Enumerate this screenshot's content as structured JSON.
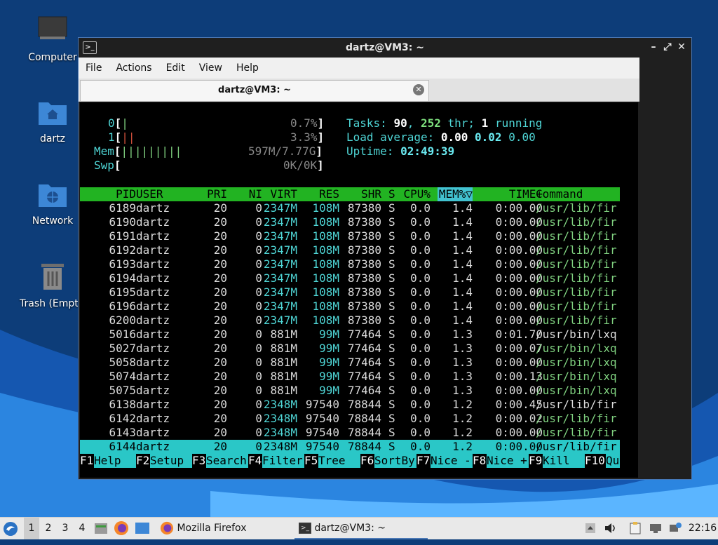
{
  "desktop": {
    "icons": [
      {
        "label": "Computer",
        "icon": "computer-icon"
      },
      {
        "label": "dartz",
        "icon": "home-folder-icon"
      },
      {
        "label": "Network",
        "icon": "network-folder-icon"
      },
      {
        "label": "Trash (Empt",
        "icon": "trash-icon"
      }
    ]
  },
  "window": {
    "title": "dartz@VM3: ~",
    "controls": {
      "minimize": "–",
      "maximize": "⤢",
      "close": "✕"
    },
    "menu": [
      "File",
      "Actions",
      "Edit",
      "View",
      "Help"
    ],
    "tab": {
      "label": "dartz@VM3: ~",
      "close": "✕"
    }
  },
  "htop": {
    "meters": {
      "cpu0": {
        "label": "0",
        "bars": "|",
        "value": "0.7%"
      },
      "cpu1": {
        "label": "1",
        "bars": "||",
        "value": "3.3%"
      },
      "mem": {
        "label": "Mem",
        "bars": "|||||||||",
        "value": "597M/7.77G"
      },
      "swp": {
        "label": "Swp",
        "bars": "",
        "value": "0K/0K"
      }
    },
    "tasks": {
      "prefix": "Tasks: ",
      "count": "90",
      "sep": ", ",
      "threads": "252",
      "thr_label": " thr; ",
      "running": "1",
      "running_label": " running"
    },
    "load": {
      "label": "Load average: ",
      "v1": "0.00",
      "v5": "0.02",
      "v15": "0.00"
    },
    "uptime": {
      "label": "Uptime: ",
      "value": "02:49:39"
    },
    "columns": [
      "PID",
      "USER",
      "PRI",
      "NI",
      "VIRT",
      "RES",
      "SHR",
      "S",
      "CPU%",
      "MEM%▽",
      "TIME+",
      "Command"
    ],
    "processes": [
      {
        "pid": "6189",
        "user": "dartz",
        "pri": "20",
        "ni": "0",
        "virt": "2347M",
        "res": "108M",
        "shr": "87380",
        "s": "S",
        "cpu": "0.0",
        "mem": "1.4",
        "time": "0:00.00",
        "cmd": "/usr/lib/fir",
        "thread": true
      },
      {
        "pid": "6190",
        "user": "dartz",
        "pri": "20",
        "ni": "0",
        "virt": "2347M",
        "res": "108M",
        "shr": "87380",
        "s": "S",
        "cpu": "0.0",
        "mem": "1.4",
        "time": "0:00.00",
        "cmd": "/usr/lib/fir",
        "thread": true
      },
      {
        "pid": "6191",
        "user": "dartz",
        "pri": "20",
        "ni": "0",
        "virt": "2347M",
        "res": "108M",
        "shr": "87380",
        "s": "S",
        "cpu": "0.0",
        "mem": "1.4",
        "time": "0:00.00",
        "cmd": "/usr/lib/fir",
        "thread": true
      },
      {
        "pid": "6192",
        "user": "dartz",
        "pri": "20",
        "ni": "0",
        "virt": "2347M",
        "res": "108M",
        "shr": "87380",
        "s": "S",
        "cpu": "0.0",
        "mem": "1.4",
        "time": "0:00.00",
        "cmd": "/usr/lib/fir",
        "thread": true
      },
      {
        "pid": "6193",
        "user": "dartz",
        "pri": "20",
        "ni": "0",
        "virt": "2347M",
        "res": "108M",
        "shr": "87380",
        "s": "S",
        "cpu": "0.0",
        "mem": "1.4",
        "time": "0:00.00",
        "cmd": "/usr/lib/fir",
        "thread": true
      },
      {
        "pid": "6194",
        "user": "dartz",
        "pri": "20",
        "ni": "0",
        "virt": "2347M",
        "res": "108M",
        "shr": "87380",
        "s": "S",
        "cpu": "0.0",
        "mem": "1.4",
        "time": "0:00.00",
        "cmd": "/usr/lib/fir",
        "thread": true
      },
      {
        "pid": "6195",
        "user": "dartz",
        "pri": "20",
        "ni": "0",
        "virt": "2347M",
        "res": "108M",
        "shr": "87380",
        "s": "S",
        "cpu": "0.0",
        "mem": "1.4",
        "time": "0:00.00",
        "cmd": "/usr/lib/fir",
        "thread": true
      },
      {
        "pid": "6196",
        "user": "dartz",
        "pri": "20",
        "ni": "0",
        "virt": "2347M",
        "res": "108M",
        "shr": "87380",
        "s": "S",
        "cpu": "0.0",
        "mem": "1.4",
        "time": "0:00.00",
        "cmd": "/usr/lib/fir",
        "thread": true
      },
      {
        "pid": "6200",
        "user": "dartz",
        "pri": "20",
        "ni": "0",
        "virt": "2347M",
        "res": "108M",
        "shr": "87380",
        "s": "S",
        "cpu": "0.0",
        "mem": "1.4",
        "time": "0:00.00",
        "cmd": "/usr/lib/fir",
        "thread": true
      },
      {
        "pid": "5016",
        "user": "dartz",
        "pri": "20",
        "ni": "0",
        "virt": "881M",
        "res": "99M",
        "shr": "77464",
        "s": "S",
        "cpu": "0.0",
        "mem": "1.3",
        "time": "0:01.70",
        "cmd": "/usr/bin/lxq",
        "thread": false
      },
      {
        "pid": "5027",
        "user": "dartz",
        "pri": "20",
        "ni": "0",
        "virt": "881M",
        "res": "99M",
        "shr": "77464",
        "s": "S",
        "cpu": "0.0",
        "mem": "1.3",
        "time": "0:00.07",
        "cmd": "/usr/bin/lxq",
        "thread": true
      },
      {
        "pid": "5058",
        "user": "dartz",
        "pri": "20",
        "ni": "0",
        "virt": "881M",
        "res": "99M",
        "shr": "77464",
        "s": "S",
        "cpu": "0.0",
        "mem": "1.3",
        "time": "0:00.00",
        "cmd": "/usr/bin/lxq",
        "thread": true
      },
      {
        "pid": "5074",
        "user": "dartz",
        "pri": "20",
        "ni": "0",
        "virt": "881M",
        "res": "99M",
        "shr": "77464",
        "s": "S",
        "cpu": "0.0",
        "mem": "1.3",
        "time": "0:00.13",
        "cmd": "/usr/bin/lxq",
        "thread": true
      },
      {
        "pid": "5075",
        "user": "dartz",
        "pri": "20",
        "ni": "0",
        "virt": "881M",
        "res": "99M",
        "shr": "77464",
        "s": "S",
        "cpu": "0.0",
        "mem": "1.3",
        "time": "0:00.00",
        "cmd": "/usr/bin/lxq",
        "thread": true
      },
      {
        "pid": "6138",
        "user": "dartz",
        "pri": "20",
        "ni": "0",
        "virt": "2348M",
        "res": "97540",
        "shr": "78844",
        "s": "S",
        "cpu": "0.0",
        "mem": "1.2",
        "time": "0:00.45",
        "cmd": "/usr/lib/fir",
        "thread": false
      },
      {
        "pid": "6142",
        "user": "dartz",
        "pri": "20",
        "ni": "0",
        "virt": "2348M",
        "res": "97540",
        "shr": "78844",
        "s": "S",
        "cpu": "0.0",
        "mem": "1.2",
        "time": "0:00.02",
        "cmd": "/usr/lib/fir",
        "thread": true
      },
      {
        "pid": "6143",
        "user": "dartz",
        "pri": "20",
        "ni": "0",
        "virt": "2348M",
        "res": "97540",
        "shr": "78844",
        "s": "S",
        "cpu": "0.0",
        "mem": "1.2",
        "time": "0:00.00",
        "cmd": "/usr/lib/fir",
        "thread": true
      },
      {
        "pid": "6144",
        "user": "dartz",
        "pri": "20",
        "ni": "0",
        "virt": "2348M",
        "res": "97540",
        "shr": "78844",
        "s": "S",
        "cpu": "0.0",
        "mem": "1.2",
        "time": "0:00.00",
        "cmd": "/usr/lib/fir",
        "thread": true,
        "selected": true
      }
    ],
    "function_keys": [
      {
        "key": "F1",
        "label": "Help"
      },
      {
        "key": "F2",
        "label": "Setup"
      },
      {
        "key": "F3",
        "label": "Search"
      },
      {
        "key": "F4",
        "label": "Filter"
      },
      {
        "key": "F5",
        "label": "Tree"
      },
      {
        "key": "F6",
        "label": "SortBy"
      },
      {
        "key": "F7",
        "label": "Nice -"
      },
      {
        "key": "F8",
        "label": "Nice +"
      },
      {
        "key": "F9",
        "label": "Kill"
      },
      {
        "key": "F10",
        "label": "Qu"
      }
    ]
  },
  "taskbar": {
    "workspaces": [
      "1",
      "2",
      "3",
      "4"
    ],
    "active_workspace": "1",
    "tasks": [
      {
        "label": "Mozilla Firefox",
        "icon": "firefox-icon"
      },
      {
        "label": "dartz@VM3: ~",
        "icon": "terminal-icon"
      }
    ],
    "clock": "22:16"
  },
  "colors": {
    "header_bg": "#22b322",
    "selected_row_bg": "#2ac7c7",
    "window_border": "#4a77b4",
    "desktop_bg": "#0d3d79"
  }
}
